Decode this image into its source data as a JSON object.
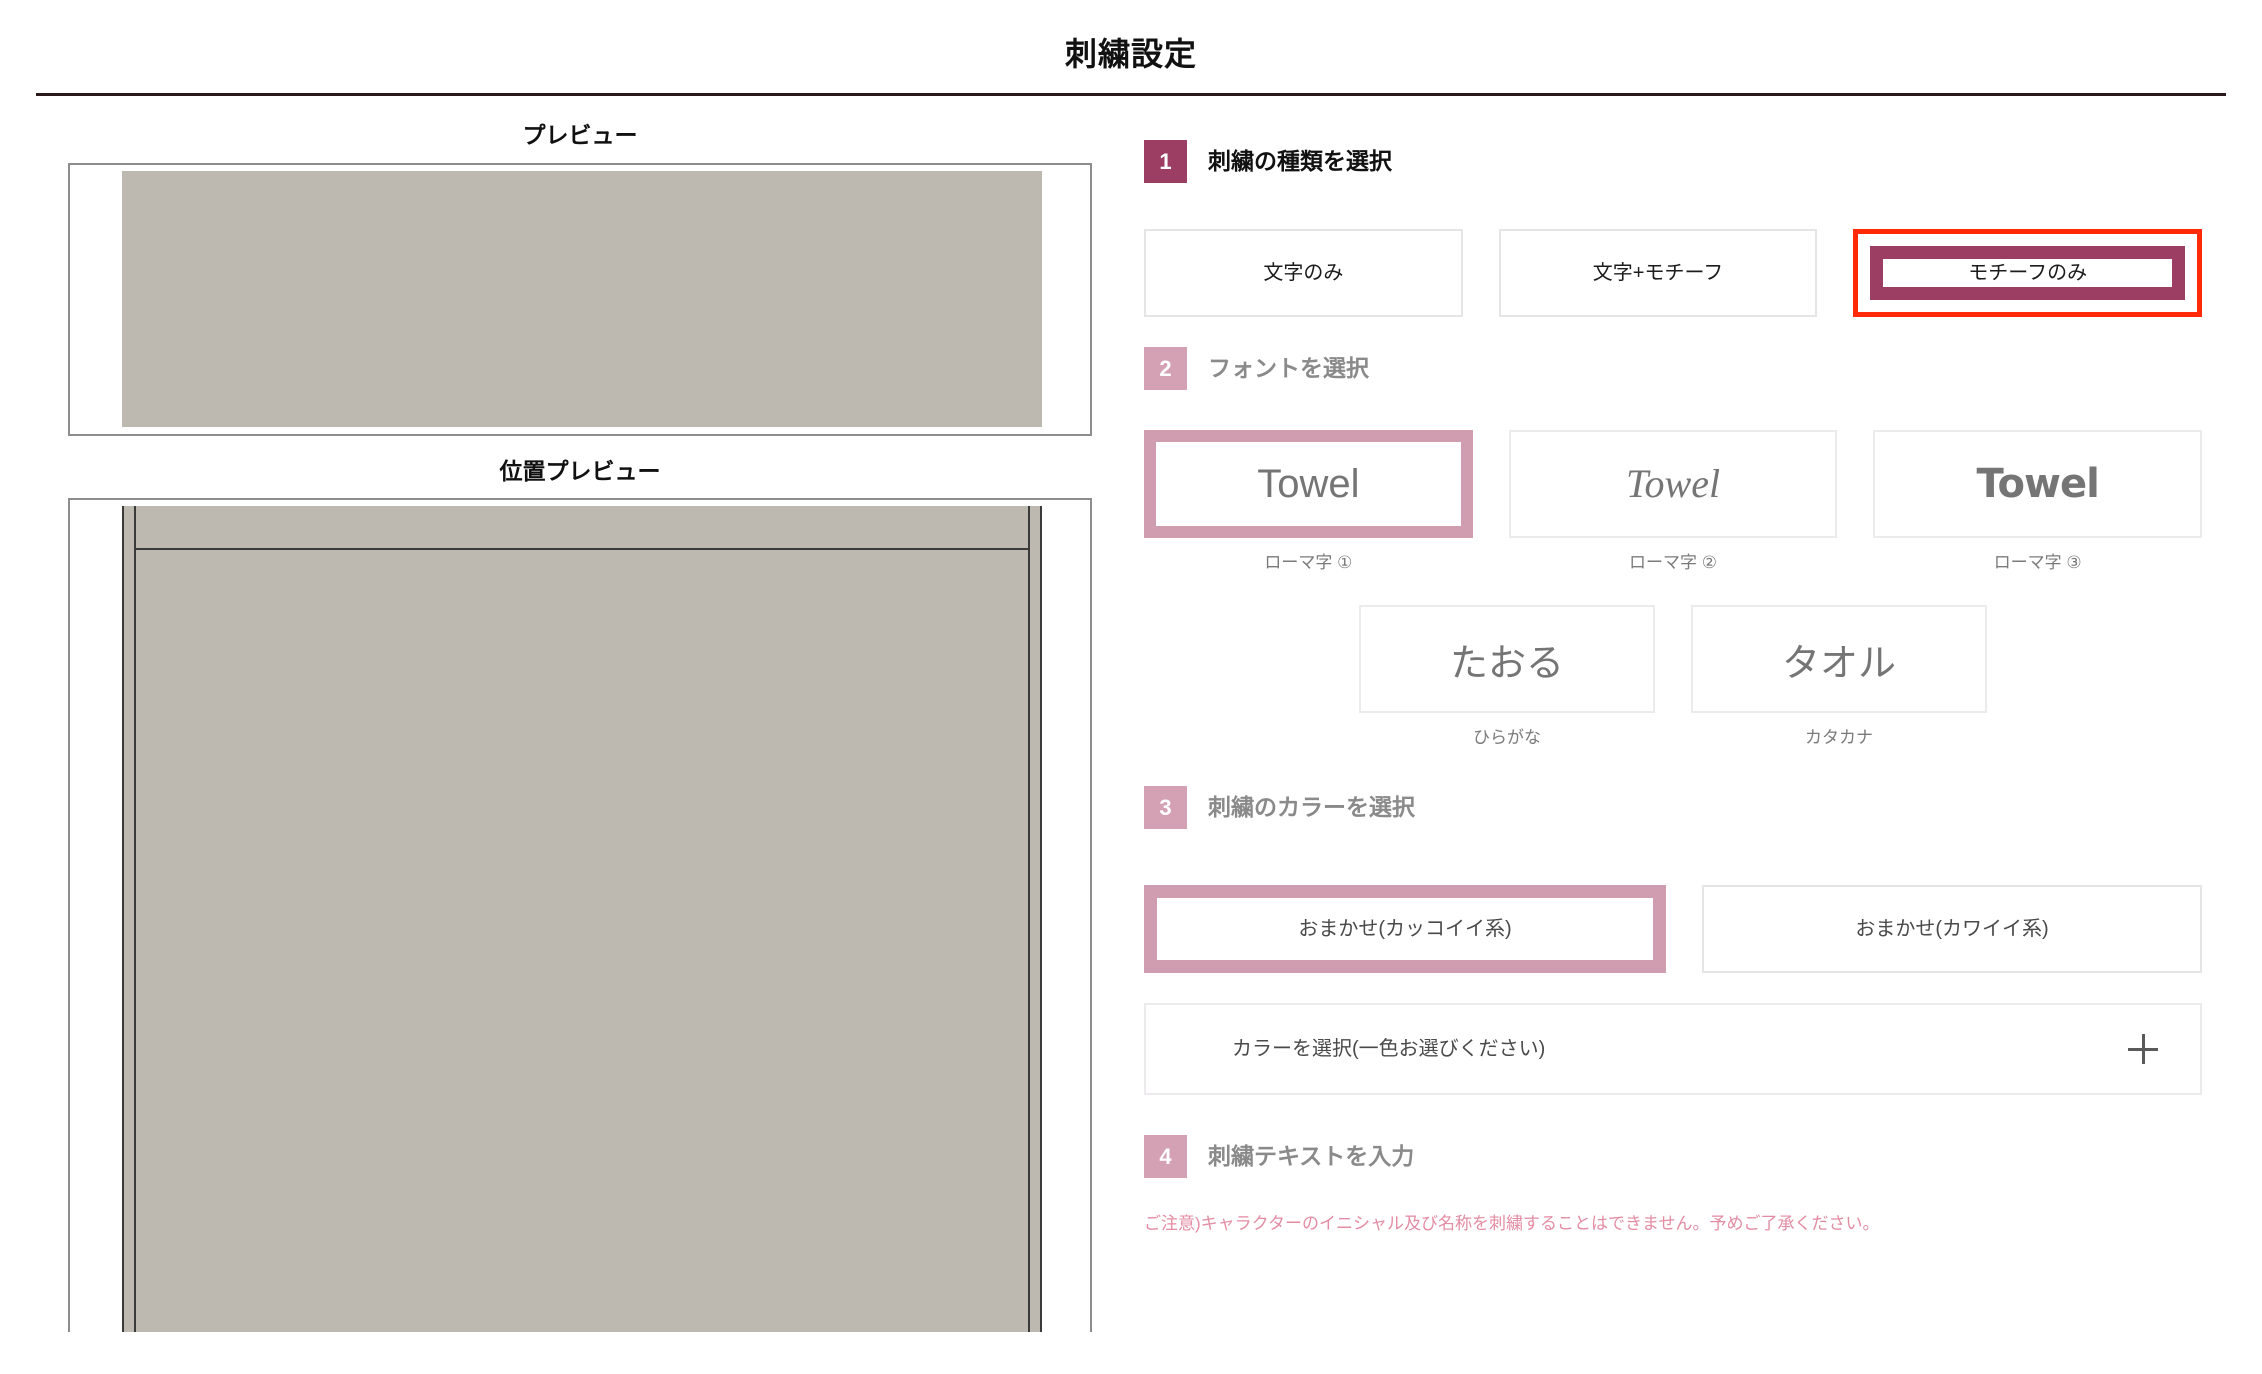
{
  "header": {
    "title": "刺繍設定"
  },
  "left_panel": {
    "preview_caption": "プレビュー",
    "position_caption": "位置プレビュー"
  },
  "steps": {
    "step1": {
      "number": "1",
      "label": "刺繍の種類を選択",
      "options": [
        {
          "label": "文字のみ",
          "selected": false
        },
        {
          "label": "文字+モチーフ",
          "selected": false
        },
        {
          "label": "モチーフのみ",
          "selected": true
        }
      ]
    },
    "step2": {
      "number": "2",
      "label": "フォントを選択",
      "fonts": [
        {
          "sample": "Towel",
          "caption": "ローマ字 ①",
          "selected": true
        },
        {
          "sample": "Towel",
          "caption": "ローマ字 ②",
          "selected": false
        },
        {
          "sample": "Towel",
          "caption": "ローマ字 ③",
          "selected": false
        }
      ],
      "kana_fonts": [
        {
          "sample": "たおる",
          "caption": "ひらがな",
          "selected": false
        },
        {
          "sample": "タオル",
          "caption": "カタカナ",
          "selected": false
        }
      ]
    },
    "step3": {
      "number": "3",
      "label": "刺繍のカラーを選択",
      "presets": [
        {
          "label": "おまかせ(カッコイイ系)",
          "selected": true
        },
        {
          "label": "おまかせ(カワイイ系)",
          "selected": false
        }
      ],
      "color_picker": {
        "label": "カラーを選択(一色お選びください)",
        "icon": "plus-icon"
      }
    },
    "step4": {
      "number": "4",
      "label": "刺繍テキストを入力",
      "notice": "ご注意)キャラクターのイニシャル及び名称を刺繍することはできません。予めご了承ください。"
    }
  },
  "colors": {
    "accent_wine": "#9c3d63",
    "accent_pink": "#cf9cb0",
    "badge_muted": "#d4a0b4",
    "focus_red": "#ff2a08",
    "swatch_grey": "#bdb8b0",
    "notice_pink": "#e38ca3"
  }
}
